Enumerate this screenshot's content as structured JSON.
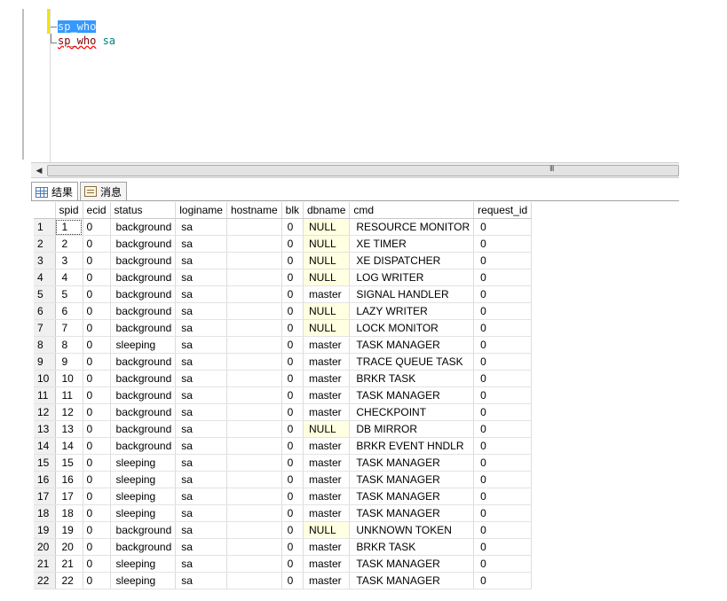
{
  "editor": {
    "lines": [
      {
        "keyword": "sp_who",
        "arg": ""
      },
      {
        "keyword": "sp_who",
        "arg": " sa"
      }
    ],
    "scroll_grip": "III"
  },
  "tabs": [
    {
      "label": "结果",
      "icon": "grid-icon"
    },
    {
      "label": "消息",
      "icon": "message-icon"
    }
  ],
  "results": {
    "columns": [
      "spid",
      "ecid",
      "status",
      "loginame",
      "hostname",
      "blk",
      "dbname",
      "cmd",
      "request_id"
    ],
    "rows": [
      [
        "1",
        "1",
        "0",
        "background",
        "sa",
        "",
        "0",
        "NULL",
        "RESOURCE MONITOR",
        "0"
      ],
      [
        "2",
        "2",
        "0",
        "background",
        "sa",
        "",
        "0",
        "NULL",
        "XE TIMER",
        "0"
      ],
      [
        "3",
        "3",
        "0",
        "background",
        "sa",
        "",
        "0",
        "NULL",
        "XE DISPATCHER",
        "0"
      ],
      [
        "4",
        "4",
        "0",
        "background",
        "sa",
        "",
        "0",
        "NULL",
        "LOG WRITER",
        "0"
      ],
      [
        "5",
        "5",
        "0",
        "background",
        "sa",
        "",
        "0",
        "master",
        "SIGNAL HANDLER",
        "0"
      ],
      [
        "6",
        "6",
        "0",
        "background",
        "sa",
        "",
        "0",
        "NULL",
        "LAZY WRITER",
        "0"
      ],
      [
        "7",
        "7",
        "0",
        "background",
        "sa",
        "",
        "0",
        "NULL",
        "LOCK MONITOR",
        "0"
      ],
      [
        "8",
        "8",
        "0",
        "sleeping",
        "sa",
        "",
        "0",
        "master",
        "TASK MANAGER",
        "0"
      ],
      [
        "9",
        "9",
        "0",
        "background",
        "sa",
        "",
        "0",
        "master",
        "TRACE QUEUE TASK",
        "0"
      ],
      [
        "10",
        "10",
        "0",
        "background",
        "sa",
        "",
        "0",
        "master",
        "BRKR TASK",
        "0"
      ],
      [
        "11",
        "11",
        "0",
        "background",
        "sa",
        "",
        "0",
        "master",
        "TASK MANAGER",
        "0"
      ],
      [
        "12",
        "12",
        "0",
        "background",
        "sa",
        "",
        "0",
        "master",
        "CHECKPOINT",
        "0"
      ],
      [
        "13",
        "13",
        "0",
        "background",
        "sa",
        "",
        "0",
        "NULL",
        "DB MIRROR",
        "0"
      ],
      [
        "14",
        "14",
        "0",
        "background",
        "sa",
        "",
        "0",
        "master",
        "BRKR EVENT HNDLR",
        "0"
      ],
      [
        "15",
        "15",
        "0",
        "sleeping",
        "sa",
        "",
        "0",
        "master",
        "TASK MANAGER",
        "0"
      ],
      [
        "16",
        "16",
        "0",
        "sleeping",
        "sa",
        "",
        "0",
        "master",
        "TASK MANAGER",
        "0"
      ],
      [
        "17",
        "17",
        "0",
        "sleeping",
        "sa",
        "",
        "0",
        "master",
        "TASK MANAGER",
        "0"
      ],
      [
        "18",
        "18",
        "0",
        "sleeping",
        "sa",
        "",
        "0",
        "master",
        "TASK MANAGER",
        "0"
      ],
      [
        "19",
        "19",
        "0",
        "background",
        "sa",
        "",
        "0",
        "NULL",
        "UNKNOWN TOKEN",
        "0"
      ],
      [
        "20",
        "20",
        "0",
        "background",
        "sa",
        "",
        "0",
        "master",
        "BRKR TASK",
        "0"
      ],
      [
        "21",
        "21",
        "0",
        "sleeping",
        "sa",
        "",
        "0",
        "master",
        "TASK MANAGER",
        "0"
      ],
      [
        "22",
        "22",
        "0",
        "sleeping",
        "sa",
        "",
        "0",
        "master",
        "TASK MANAGER",
        "0"
      ]
    ]
  },
  "colors": {
    "selection": "#3399ff",
    "null_cell": "#ffffe1",
    "keyword": "#800000",
    "argument": "#008080"
  }
}
